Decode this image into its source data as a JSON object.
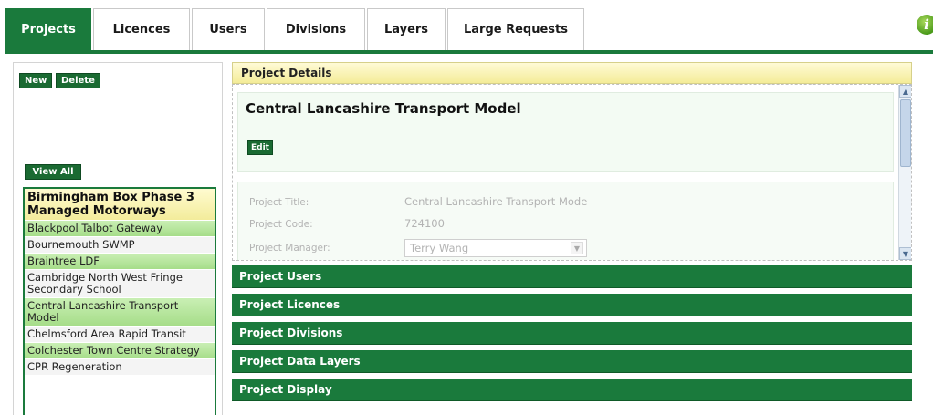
{
  "tabs": [
    {
      "label": "Projects",
      "active": true
    },
    {
      "label": "Licences",
      "active": false
    },
    {
      "label": "Users",
      "active": false
    },
    {
      "label": "Divisions",
      "active": false
    },
    {
      "label": "Layers",
      "active": false
    },
    {
      "label": "Large Requests",
      "active": false
    }
  ],
  "left": {
    "new_label": "New",
    "delete_label": "Delete",
    "view_all_label": "View All",
    "projects": [
      {
        "name": "Birmingham Box Phase 3 Managed Motorways",
        "style": "selected"
      },
      {
        "name": "Blackpool Talbot Gateway",
        "style": "green"
      },
      {
        "name": "Bournemouth SWMP",
        "style": "white"
      },
      {
        "name": "Braintree LDF",
        "style": "green"
      },
      {
        "name": "Cambridge North West Fringe Secondary School",
        "style": "white"
      },
      {
        "name": "Central Lancashire Transport Model",
        "style": "green"
      },
      {
        "name": "Chelmsford Area Rapid Transit",
        "style": "white"
      },
      {
        "name": "Colchester Town Centre Strategy",
        "style": "green"
      },
      {
        "name": "CPR Regeneration",
        "style": "white"
      }
    ]
  },
  "details": {
    "header": "Project Details",
    "project_name": "Central Lancashire Transport Model",
    "edit_label": "Edit",
    "fields": {
      "title_label": "Project Title:",
      "title_value": "Central Lancashire Transport Mode",
      "code_label": "Project Code:",
      "code_value": "724100",
      "manager_label": "Project Manager:",
      "manager_value": "Terry Wang"
    }
  },
  "sections": [
    "Project Users",
    "Project Licences",
    "Project Divisions",
    "Project Data Layers",
    "Project Display"
  ],
  "colors": {
    "accent_green": "#1a7a3c",
    "header_yellow": "#f4ec98"
  }
}
